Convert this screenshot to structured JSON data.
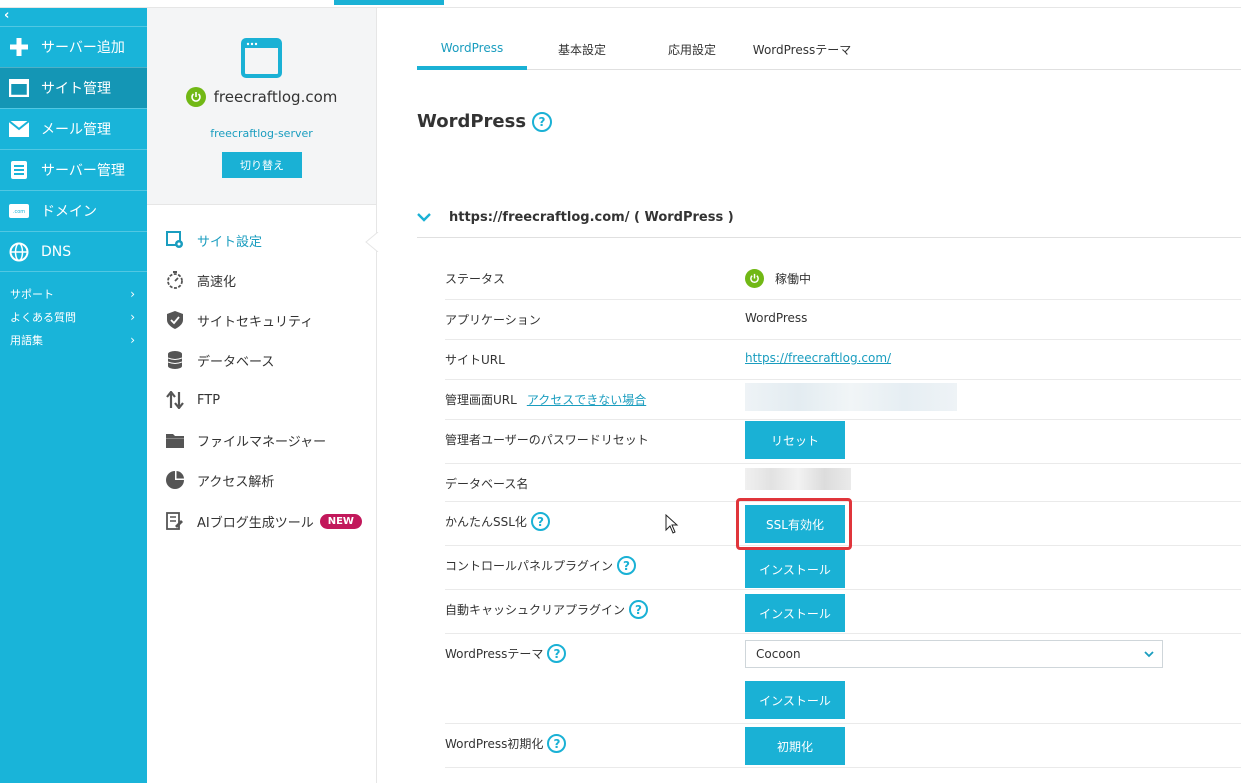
{
  "leftnav": {
    "collapse_glyph": "‹",
    "items": [
      {
        "label": "サーバー追加",
        "icon": "plus-icon"
      },
      {
        "label": "サイト管理",
        "icon": "window-icon",
        "active": true
      },
      {
        "label": "メール管理",
        "icon": "mail-icon"
      },
      {
        "label": "サーバー管理",
        "icon": "server-icon"
      },
      {
        "label": "ドメイン",
        "icon": "domain-icon"
      },
      {
        "label": "DNS",
        "icon": "globe-icon"
      }
    ],
    "sub_items": [
      {
        "label": "サポート"
      },
      {
        "label": "よくある質問"
      },
      {
        "label": "用語集"
      }
    ]
  },
  "site": {
    "domain": "freecraftlog.com",
    "server": "freecraftlog-server",
    "switch_label": "切り替え"
  },
  "site_menu": [
    {
      "label": "サイト設定",
      "icon": "site-settings-icon",
      "active": true
    },
    {
      "label": "高速化",
      "icon": "stopwatch-icon"
    },
    {
      "label": "サイトセキュリティ",
      "icon": "shield-icon"
    },
    {
      "label": "データベース",
      "icon": "database-icon"
    },
    {
      "label": "FTP",
      "icon": "transfer-arrows-icon"
    },
    {
      "label": "ファイルマネージャー",
      "icon": "folder-icon"
    },
    {
      "label": "アクセス解析",
      "icon": "pie-chart-icon"
    },
    {
      "label": "AIブログ生成ツール",
      "icon": "ai-doc-icon",
      "badge": "NEW"
    }
  ],
  "tabs": [
    {
      "label": "WordPress",
      "active": true
    },
    {
      "label": "基本設定"
    },
    {
      "label": "応用設定"
    },
    {
      "label": "WordPressテーマ"
    }
  ],
  "page_title": "WordPress",
  "section_header": "https://freecraftlog.com/ ( WordPress )",
  "rows": {
    "status": {
      "label": "ステータス",
      "value": "稼働中"
    },
    "application": {
      "label": "アプリケーション",
      "value": "WordPress"
    },
    "site_url": {
      "label": "サイトURL",
      "value": "https://freecraftlog.com/"
    },
    "admin_url": {
      "label": "管理画面URL",
      "link": "アクセスできない場合"
    },
    "password_reset": {
      "label": "管理者ユーザーのパスワードリセット",
      "button": "リセット"
    },
    "db_name": {
      "label": "データベース名"
    },
    "ssl": {
      "label": "かんたんSSL化",
      "button": "SSL有効化"
    },
    "control_panel_plugin": {
      "label": "コントロールパネルプラグイン",
      "button": "インストール"
    },
    "cache_plugin": {
      "label": "自動キャッシュクリアプラグイン",
      "button": "インストール"
    },
    "theme": {
      "label": "WordPressテーマ",
      "selected": "Cocoon",
      "button": "インストール"
    },
    "reset": {
      "label": "WordPress初期化",
      "button": "初期化"
    }
  },
  "colors": {
    "accent": "#1ab1d5",
    "nav_active": "#1496b5",
    "status_green": "#71b815",
    "highlight_red": "#e0353b",
    "badge": "#c2185b"
  }
}
